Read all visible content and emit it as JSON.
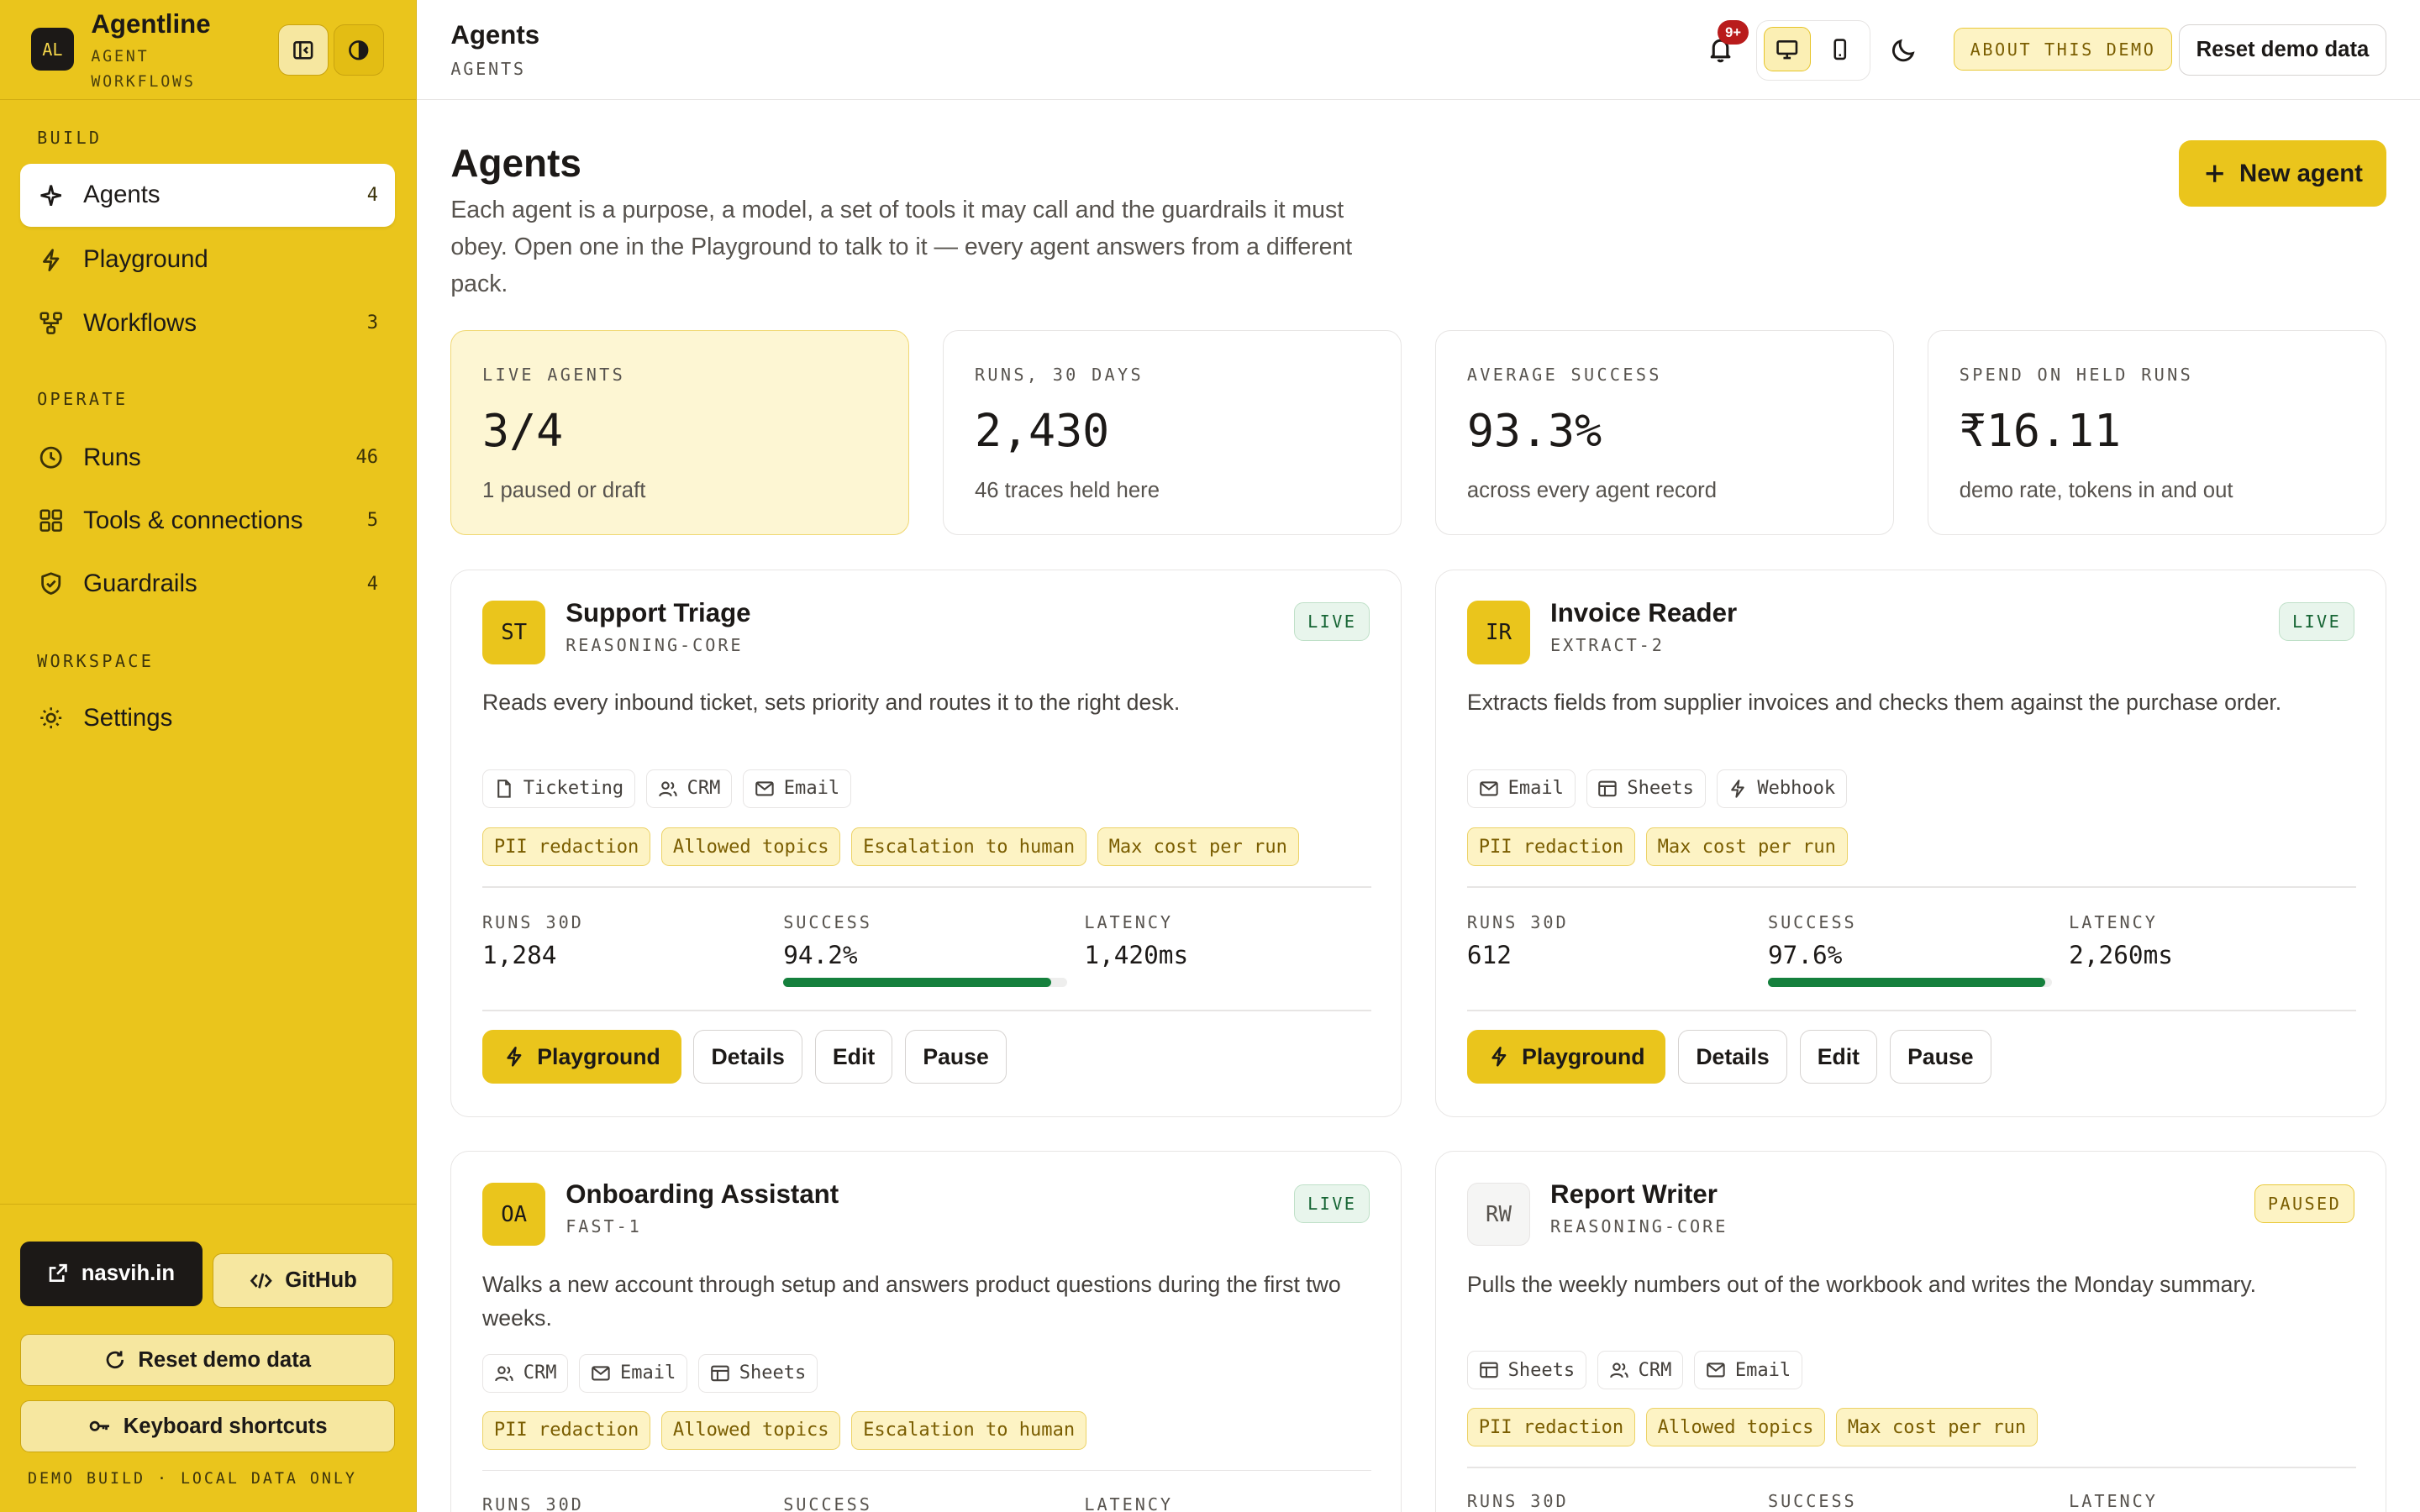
{
  "brand": {
    "logo": "AL",
    "name": "Agentline",
    "subtitle_1": "AGENT",
    "subtitle_2": "WORKFLOWS"
  },
  "sidebar": {
    "sections": {
      "build": "BUILD",
      "operate": "OPERATE",
      "workspace": "WORKSPACE"
    },
    "items": [
      {
        "label": "Agents",
        "count": "4",
        "icon": "sparkle-icon",
        "active": true
      },
      {
        "label": "Playground",
        "count": "",
        "icon": "bolt-icon"
      },
      {
        "label": "Workflows",
        "count": "3",
        "icon": "workflow-icon"
      },
      {
        "label": "Runs",
        "count": "46",
        "icon": "clock-icon"
      },
      {
        "label": "Tools & connections",
        "count": "5",
        "icon": "grid-icon"
      },
      {
        "label": "Guardrails",
        "count": "4",
        "icon": "shield-icon"
      },
      {
        "label": "Settings",
        "count": "",
        "icon": "gear-icon"
      }
    ],
    "footer": {
      "site": "nasvih.in",
      "github": "GitHub",
      "reset": "Reset demo data",
      "shortcuts": "Keyboard shortcuts",
      "note": "DEMO BUILD · LOCAL DATA ONLY"
    }
  },
  "topbar": {
    "title": "Agents",
    "subtitle": "AGENTS",
    "notifications": "9+",
    "about": "ABOUT THIS DEMO",
    "reset": "Reset demo data"
  },
  "main": {
    "title": "Agents",
    "description": "Each agent is a purpose, a model, a set of tools it may call and the guardrails it must obey. Open one in the Playground to talk to it — every agent answers from a different pack.",
    "new_agent": "New agent"
  },
  "stats": [
    {
      "label": "LIVE AGENTS",
      "value": "3/4",
      "sub": "1 paused or draft"
    },
    {
      "label": "RUNS, 30 DAYS",
      "value": "2,430",
      "sub": "46 traces held here"
    },
    {
      "label": "AVERAGE SUCCESS",
      "value": "93.3%",
      "sub": "across every agent record"
    },
    {
      "label": "SPEND ON HELD RUNS",
      "value": "₹16.11",
      "sub": "demo rate, tokens in and out"
    }
  ],
  "metric_labels": {
    "runs": "RUNS 30D",
    "success": "SUCCESS",
    "latency": "LATENCY"
  },
  "action_labels": {
    "playground": "Playground",
    "details": "Details",
    "edit": "Edit",
    "pause": "Pause"
  },
  "agents": [
    {
      "initials": "ST",
      "name": "Support Triage",
      "model": "REASONING-CORE",
      "status": "LIVE",
      "description": "Reads every inbound ticket, sets priority and routes it to the right desk.",
      "tools": [
        {
          "name": "Ticketing",
          "icon": "file-icon"
        },
        {
          "name": "CRM",
          "icon": "users-icon"
        },
        {
          "name": "Email",
          "icon": "mail-icon"
        }
      ],
      "guardrails": [
        "PII redaction",
        "Allowed topics",
        "Escalation to human",
        "Max cost per run"
      ],
      "runs": "1,284",
      "success": "94.2%",
      "success_value": 0.942,
      "latency": "1,420ms"
    },
    {
      "initials": "IR",
      "name": "Invoice Reader",
      "model": "EXTRACT-2",
      "status": "LIVE",
      "description": "Extracts fields from supplier invoices and checks them against the purchase order.",
      "tools": [
        {
          "name": "Email",
          "icon": "mail-icon"
        },
        {
          "name": "Sheets",
          "icon": "table-icon"
        },
        {
          "name": "Webhook",
          "icon": "bolt-icon"
        }
      ],
      "guardrails": [
        "PII redaction",
        "Max cost per run"
      ],
      "runs": "612",
      "success": "97.6%",
      "success_value": 0.976,
      "latency": "2,260ms"
    },
    {
      "initials": "OA",
      "name": "Onboarding Assistant",
      "model": "FAST-1",
      "status": "LIVE",
      "description": "Walks a new account through setup and answers product questions during the first two weeks.",
      "tools": [
        {
          "name": "CRM",
          "icon": "users-icon"
        },
        {
          "name": "Email",
          "icon": "mail-icon"
        },
        {
          "name": "Sheets",
          "icon": "table-icon"
        }
      ],
      "guardrails": [
        "PII redaction",
        "Allowed topics",
        "Escalation to human"
      ]
    },
    {
      "initials": "RW",
      "name": "Report Writer",
      "model": "REASONING-CORE",
      "status": "PAUSED",
      "description": "Pulls the weekly numbers out of the workbook and writes the Monday summary.",
      "tools": [
        {
          "name": "Sheets",
          "icon": "table-icon"
        },
        {
          "name": "CRM",
          "icon": "users-icon"
        },
        {
          "name": "Email",
          "icon": "mail-icon"
        }
      ],
      "guardrails": [
        "PII redaction",
        "Allowed topics",
        "Max cost per run"
      ]
    }
  ]
}
